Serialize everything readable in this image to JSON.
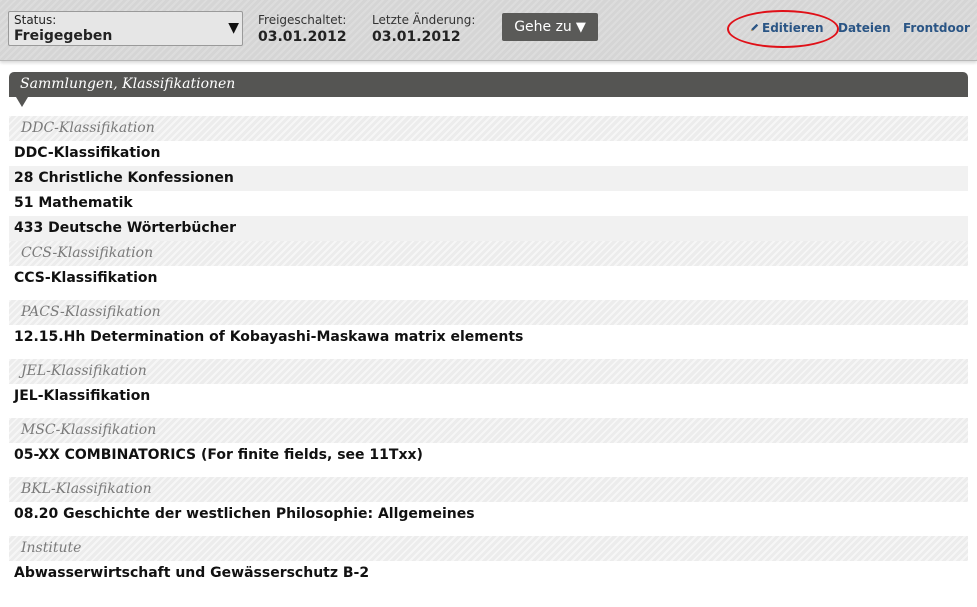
{
  "toolbar": {
    "status_label": "Status:",
    "status_value": "Freigegeben",
    "released_label": "Freigeschaltet:",
    "released_date": "03.01.2012",
    "changed_label": "Letzte Änderung:",
    "changed_date": "03.01.2012",
    "goto_label": "Gehe zu",
    "edit_label": "Editieren",
    "files_label": "Dateien",
    "frontdoor_label": "Frontdoor"
  },
  "section_title": "Sammlungen, Klassifikationen",
  "groups": [
    {
      "header": "DDC-Klassifikation",
      "items": [
        "DDC-Klassifikation",
        "28 Christliche Konfessionen",
        "51 Mathematik",
        "433 Deutsche Wörterbücher"
      ]
    },
    {
      "header": "CCS-Klassifikation",
      "items": [
        "CCS-Klassifikation"
      ]
    },
    {
      "header": "PACS-Klassifikation",
      "items": [
        "12.15.Hh Determination of Kobayashi-Maskawa matrix elements"
      ]
    },
    {
      "header": "JEL-Klassifikation",
      "items": [
        "JEL-Klassifikation"
      ]
    },
    {
      "header": "MSC-Klassifikation",
      "items": [
        "05-XX COMBINATORICS (For finite fields, see 11Txx)"
      ]
    },
    {
      "header": "BKL-Klassifikation",
      "items": [
        "08.20 Geschichte der westlichen Philosophie: Allgemeines"
      ]
    },
    {
      "header": "Institute",
      "items": [
        "Abwasserwirtschaft und Gewässerschutz B-2"
      ]
    }
  ],
  "colors": {
    "accent_link": "#2a5585",
    "highlight_ellipse": "#e01018",
    "title_bar": "#555553"
  },
  "icons": {
    "status_dropdown": "triangle-down-icon",
    "goto_dropdown": "triangle-down-icon",
    "edit": "pencil-icon"
  }
}
